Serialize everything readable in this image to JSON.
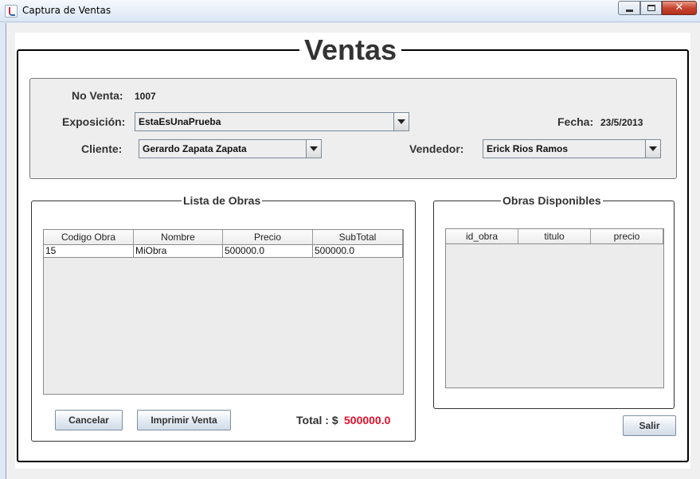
{
  "window": {
    "title": "Captura de Ventas",
    "close_glyph": "✕"
  },
  "page": {
    "title": "Ventas"
  },
  "header": {
    "no_venta_label": "No Venta:",
    "no_venta_value": "1007",
    "exposicion_label": "Exposición:",
    "exposicion_value": "EstaEsUnaPrueba",
    "fecha_label": "Fecha:",
    "fecha_value": "23/5/2013",
    "cliente_label": "Cliente:",
    "cliente_value": "Gerardo Zapata Zapata",
    "vendedor_label": "Vendedor:",
    "vendedor_value": "Erick Rios Ramos"
  },
  "lista_obras": {
    "title": "Lista de Obras",
    "columns": [
      "Codigo Obra",
      "Nombre",
      "Precio",
      "SubTotal"
    ],
    "rows": [
      [
        "15",
        "MiObra",
        "500000.0",
        "500000.0"
      ]
    ]
  },
  "obras_disponibles": {
    "title": "Obras Disponibles",
    "columns": [
      "id_obra",
      "titulo",
      "precio"
    ],
    "rows": []
  },
  "footer": {
    "cancelar_label": "Cancelar",
    "imprimir_label": "Imprimir Venta",
    "total_label": "Total : $",
    "total_value": "500000.0",
    "salir_label": "Salir"
  },
  "colors": {
    "total_value": "#e0102a",
    "border": "#333333"
  }
}
